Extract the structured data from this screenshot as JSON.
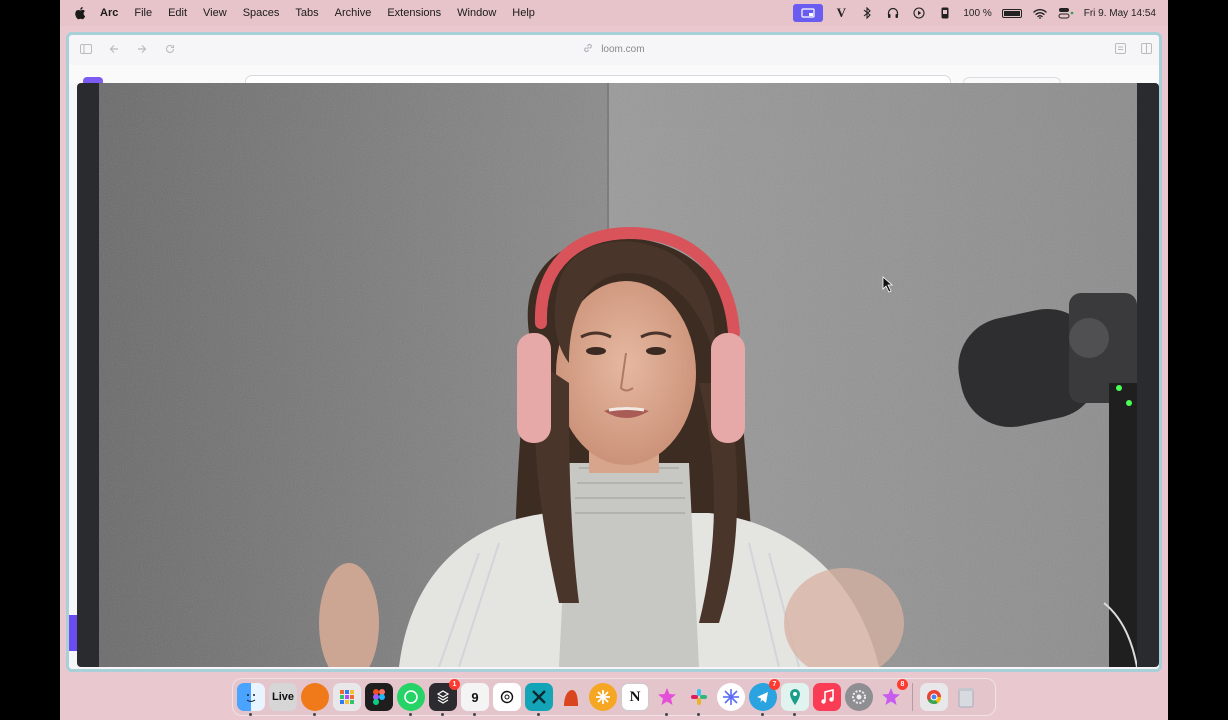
{
  "menubar": {
    "app_name": "Arc",
    "menus": [
      "File",
      "Edit",
      "View",
      "Spaces",
      "Tabs",
      "Archive",
      "Extensions",
      "Window",
      "Help"
    ],
    "battery_percent": "100 %",
    "datetime": "Fri 9. May  14:54"
  },
  "browser": {
    "url": "loom.com"
  },
  "dock": {
    "live_label": "Live",
    "calendar_day": "9",
    "notion_label": "N",
    "badges": {
      "tasks": "1",
      "telegram": "7",
      "sparkle": "8"
    }
  },
  "colors": {
    "menubar_bg": "#e7c4ca",
    "window_border": "#a9cfd9",
    "accent": "#6b4cf0"
  }
}
